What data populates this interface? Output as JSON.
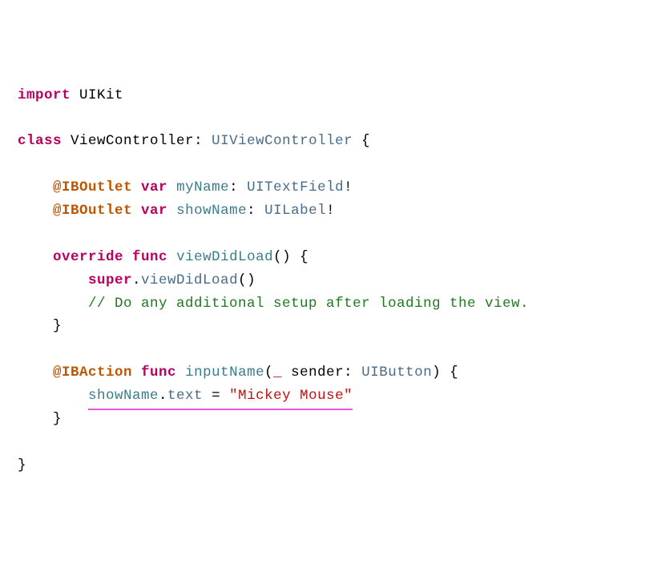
{
  "code": {
    "import_kw": "import",
    "uikit": "UIKit",
    "class_kw": "class",
    "vc_name": "ViewController",
    "colon": ":",
    "uivc": "UIViewController",
    "lbrace": "{",
    "rbrace": "}",
    "iboutlet": "@IBOutlet",
    "var_kw": "var",
    "myName": "myName",
    "showName": "showName",
    "uitextfield": "UITextField",
    "uilabel": "UILabel",
    "bang": "!",
    "override_kw": "override",
    "func_kw": "func",
    "viewDidLoad": "viewDidLoad",
    "parens": "()",
    "super_kw": "super",
    "dot": ".",
    "comment": "// Do any additional setup after loading the view.",
    "ibaction": "@IBAction",
    "inputName": "inputName",
    "lparen": "(",
    "rparen": ")",
    "underscore": "_",
    "sender": "sender",
    "uibutton": "UIButton",
    "text_prop": "text",
    "equals": " = ",
    "string_literal": "\"Mickey Mouse\""
  }
}
